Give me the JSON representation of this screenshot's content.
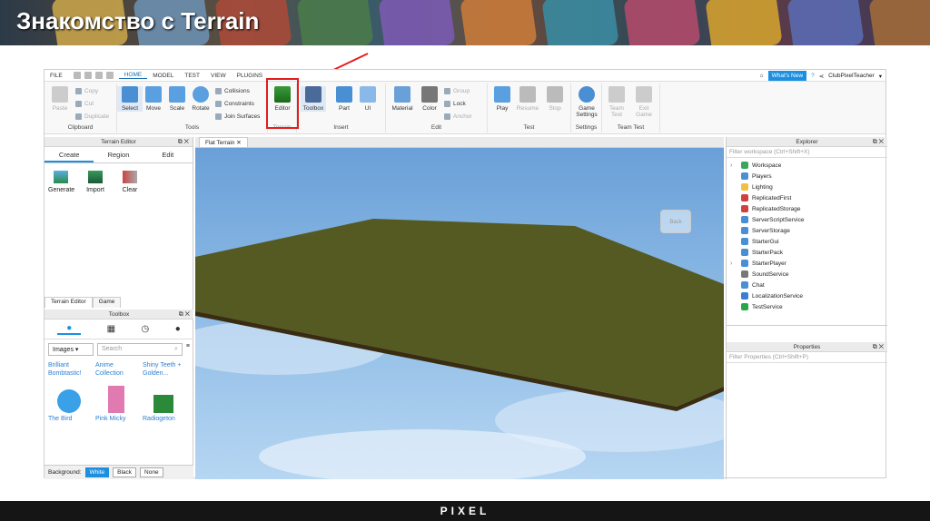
{
  "slide": {
    "title": "Знакомство с Terrain",
    "footer": "PIXEL"
  },
  "menubar": {
    "items": [
      "FILE",
      "HOME",
      "MODEL",
      "TEST",
      "VIEW",
      "PLUGINS"
    ],
    "whats_new": "What's New",
    "user": "ClubPixelTeacher"
  },
  "ribbon": {
    "clipboard": {
      "label": "Clipboard",
      "paste": "Paste",
      "copy": "Copy",
      "cut": "Cut",
      "duplicate": "Duplicate"
    },
    "tools": {
      "label": "Tools",
      "select": "Select",
      "move": "Move",
      "scale": "Scale",
      "rotate": "Rotate",
      "collisions": "Collisions",
      "constraints": "Constraints",
      "join": "Join Surfaces"
    },
    "terrain": {
      "label": "Terrain",
      "editor": "Editor"
    },
    "insert": {
      "label": "Insert",
      "toolbox": "Toolbox",
      "part": "Part",
      "ui": "UI"
    },
    "edit": {
      "label": "Edit",
      "material": "Material",
      "color": "Color",
      "group": "Group",
      "lock": "Lock",
      "anchor": "Anchor"
    },
    "test": {
      "label": "Test",
      "play": "Play",
      "resume": "Resume",
      "stop": "Stop"
    },
    "settings": {
      "label": "Settings",
      "game_settings": "Game Settings"
    },
    "team_test": {
      "label": "Team Test",
      "team": "Team Test",
      "exit": "Exit Game"
    }
  },
  "terrain_editor": {
    "title": "Terrain Editor",
    "tabs": [
      "Create",
      "Region",
      "Edit"
    ],
    "tools": [
      "Generate",
      "Import",
      "Clear"
    ],
    "bottom_tabs": [
      "Terrain Editor",
      "Game"
    ]
  },
  "toolbox": {
    "title": "Toolbox",
    "category": "Images",
    "search_placeholder": "Search",
    "items": [
      "Brilliant Bombtastic!",
      "Anime Collection",
      "Shiny Teeth + Golden..."
    ],
    "items2": [
      "The Bird",
      "Pink Micky",
      "Radiogeton"
    ],
    "background_label": "Background:",
    "bg_options": [
      "White",
      "Black",
      "None"
    ]
  },
  "viewport": {
    "tab": "Flat Terrain",
    "view_label": "Back"
  },
  "explorer": {
    "title": "Explorer",
    "filter": "Filter workspace (Ctrl+Shift+X)",
    "items": [
      "Workspace",
      "Players",
      "Lighting",
      "ReplicatedFirst",
      "ReplicatedStorage",
      "ServerScriptService",
      "ServerStorage",
      "StarterGui",
      "StarterPack",
      "StarterPlayer",
      "SoundService",
      "Chat",
      "LocalizationService",
      "TestService"
    ],
    "colors": [
      "#3aa65a",
      "#4a8fd4",
      "#f0c040",
      "#d04040",
      "#d04040",
      "#4a8fd4",
      "#4a8fd4",
      "#4a8fd4",
      "#4a8fd4",
      "#4a8fd4",
      "#777777",
      "#4a8fd4",
      "#3a7fd0",
      "#2aa64a"
    ]
  },
  "properties": {
    "title": "Properties",
    "filter": "Filter Properties (Ctrl+Shift+P)"
  }
}
